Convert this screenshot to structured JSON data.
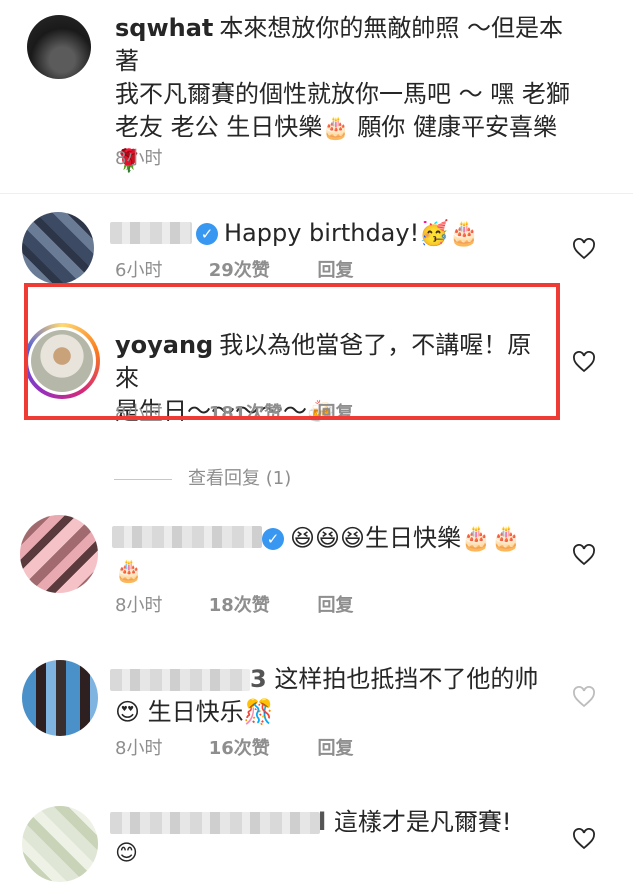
{
  "comments": [
    {
      "username": "sqwhat",
      "text": "本來想放你的無敵帥照 ～但是本著我不凡爾賽的個性就放你一馬吧 ～ 嘿 老獅老友 老公 生日快樂🎂 願你 健康平安喜樂🌹",
      "line1": "本來想放你的無敵帥照 ～但是本著",
      "line2": "我不凡爾賽的個性就放你一馬吧 ～ 嘿 老獅",
      "line3": "老友 老公 生日快樂",
      "line3b": "願你 健康平安喜樂",
      "time": "8小时",
      "likes": "",
      "reply": ""
    },
    {
      "username": "",
      "verified": true,
      "text": "Happy birthday!🥳🎂",
      "time": "6小时",
      "likes": "29次赞",
      "reply": "回复"
    },
    {
      "username": "yoyang",
      "line1": "我以為他當爸了，不講喔！原來",
      "line2": "是生日～～～～～",
      "time": "8小时",
      "likes": "181次赞",
      "reply": "回复"
    },
    {
      "username": "",
      "verified": true,
      "line1": "😆😆😆生日快樂🎂🎂",
      "time": "8小时",
      "likes": "18次赞",
      "reply": "回复"
    },
    {
      "username": "",
      "username_tail": "3",
      "line1": "这样拍也抵挡不了他的帅",
      "line2": "😍 生日快乐🎊",
      "time": "8小时",
      "likes": "16次赞",
      "reply": "回复"
    },
    {
      "username": "",
      "username_tail": "l",
      "line1": "這樣才是凡爾賽!",
      "time": "",
      "likes": "",
      "reply": ""
    }
  ],
  "view_replies": "查看回复 (1)",
  "emoji": {
    "cake": "🎂",
    "rose": "🌹",
    "party_face": "🥳",
    "beers": "🍻",
    "laugh": "😆",
    "heart_eyes": "😍",
    "confetti": "🎊",
    "smile": "😊"
  },
  "colors": {
    "highlight_box": "#ee3b33",
    "verified": "#3897f0",
    "meta_text": "#8e8e8e"
  }
}
